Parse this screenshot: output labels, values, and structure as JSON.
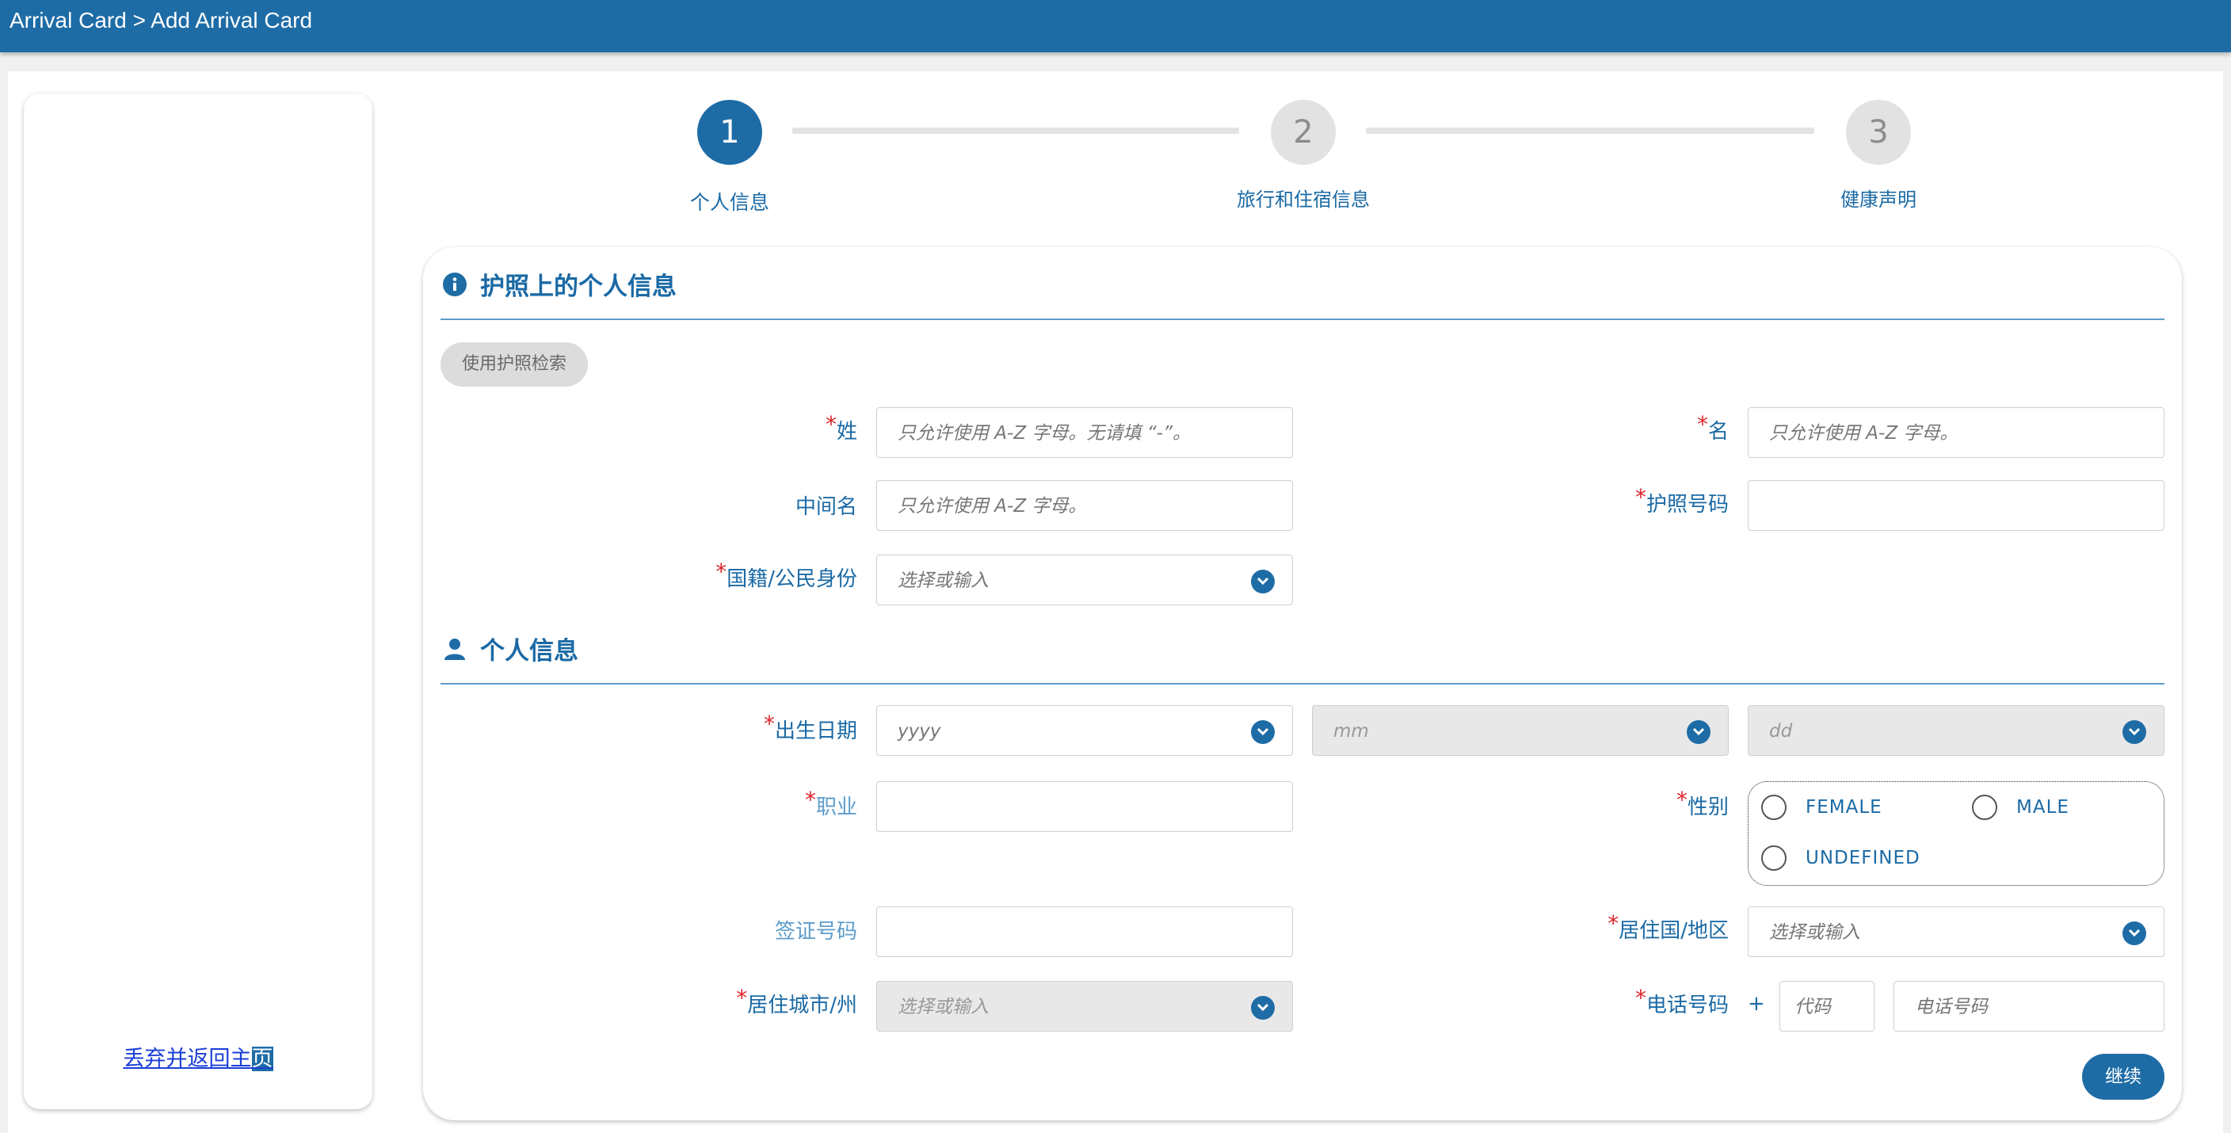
{
  "header": {
    "breadcrumb": "Arrival Card > Add Arrival Card"
  },
  "sidebar": {
    "discard_link_main": "丢弃并返回主",
    "discard_link_tail": "页"
  },
  "stepper": {
    "current_step": 1,
    "steps": [
      {
        "number": "1",
        "label": "个人信息"
      },
      {
        "number": "2",
        "label": "旅行和住宿信息"
      },
      {
        "number": "3",
        "label": "健康声明"
      }
    ]
  },
  "passport_section": {
    "title": "护照上的个人信息",
    "icon": "info-icon",
    "search_button": "使用护照检索",
    "fields": {
      "surname": {
        "label": "姓",
        "placeholder": "只允许使用 A-Z 字母。无请填 “-”。"
      },
      "given_name": {
        "label": "名",
        "placeholder": "只允许使用 A-Z 字母。"
      },
      "middle_name": {
        "label": "中间名",
        "placeholder": "只允许使用 A-Z 字母。"
      },
      "passport_number": {
        "label": "护照号码",
        "placeholder": ""
      },
      "nationality": {
        "label": "国籍/公民身份",
        "placeholder": "选择或输入"
      }
    }
  },
  "personal_section": {
    "title": "个人信息",
    "icon": "person-icon",
    "fields": {
      "dob": {
        "label": "出生日期",
        "year_placeholder": "yyyy",
        "month_placeholder": "mm",
        "day_placeholder": "dd"
      },
      "occupation": {
        "label": "职业",
        "placeholder": ""
      },
      "gender": {
        "label": "性别",
        "options": [
          "FEMALE",
          "MALE",
          "UNDEFINED"
        ]
      },
      "visa_number": {
        "label": "签证号码",
        "placeholder": ""
      },
      "residence_country": {
        "label": "居住国/地区",
        "placeholder": "选择或输入"
      },
      "residence_city": {
        "label": "居住城市/州",
        "placeholder": "选择或输入"
      },
      "phone": {
        "label": "电话号码",
        "plus": "+",
        "code_placeholder": "代码",
        "number_placeholder": "电话号码"
      }
    }
  },
  "actions": {
    "continue": "继续"
  },
  "colors": {
    "primary": "#1e6ca6",
    "required": "#e0242c",
    "disabled_bg": "#e8e8e8"
  }
}
